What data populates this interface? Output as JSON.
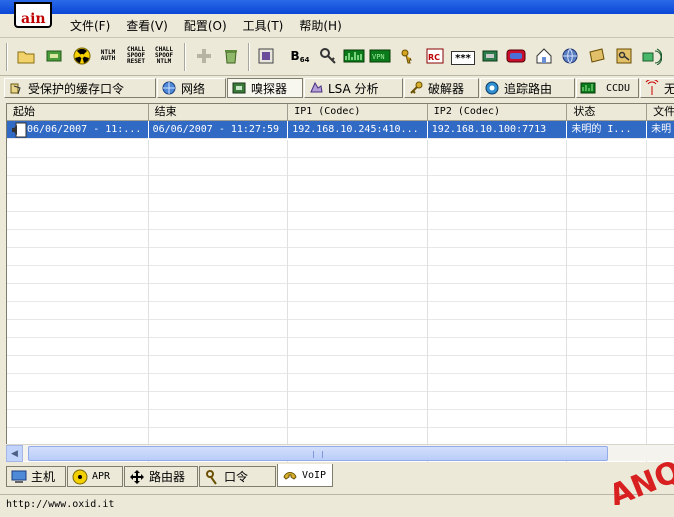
{
  "logo": {
    "text": "ain"
  },
  "menu": [
    {
      "label": "文件(F)"
    },
    {
      "label": "查看(V)"
    },
    {
      "label": "配置(O)"
    },
    {
      "label": "工具(T)"
    },
    {
      "label": "帮助(H)"
    }
  ],
  "toolbar": {
    "ntlm_auth": "NTLM AUTH",
    "chall_reset": "CHALL SPOOF RESET",
    "chall_ntlm": "CHALL SPOOF NTLM",
    "b64": "B",
    "b64_sub": "64",
    "stars": "***"
  },
  "tabs": [
    {
      "label": "受保护的缓存口令"
    },
    {
      "label": "网络"
    },
    {
      "label": "嗅探器"
    },
    {
      "label": "LSA 分析"
    },
    {
      "label": "破解器"
    },
    {
      "label": "追踪路由"
    },
    {
      "label": "CCDU"
    },
    {
      "label": "无"
    }
  ],
  "list": {
    "columns": [
      "起始",
      "结束",
      "IP1 (Codec)",
      "IP2 (Codec)",
      "状态",
      "文件"
    ],
    "rows": [
      {
        "start": "06/06/2007 - 11:...",
        "end": "06/06/2007 - 11:27:59",
        "ip1": "192.168.10.245:410...",
        "ip2": "192.168.10.100:7713",
        "status": "未明的 I...",
        "file": "未明"
      }
    ]
  },
  "bottom_tabs": [
    {
      "label": "主机"
    },
    {
      "label": "APR"
    },
    {
      "label": "路由器"
    },
    {
      "label": "口令"
    },
    {
      "label": "VoIP"
    }
  ],
  "status": {
    "text": "http://www.oxid.it"
  },
  "watermark": {
    "text": "ANQ"
  },
  "colors": {
    "selection": "#316ac5",
    "titlebar": "#0a46d6",
    "chrome": "#ece9d8"
  }
}
